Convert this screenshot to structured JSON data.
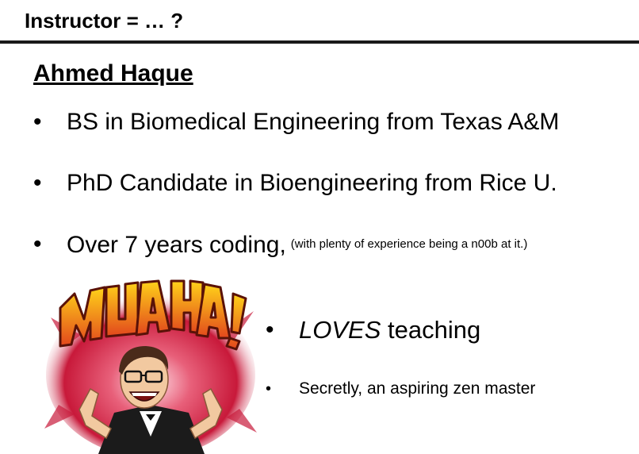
{
  "slide": {
    "title": "Instructor = … ?",
    "name": "Ahmed Haque",
    "bullets": [
      {
        "text": "BS in Biomedical Engineering from Texas A&M"
      },
      {
        "text": "PhD Candidate in Bioengineering from Rice U."
      },
      {
        "text": "Over 7 years coding,",
        "note": "(with plenty of experience being a n00b at it.)"
      }
    ],
    "side_bullets": [
      {
        "emphasis": "LOVES",
        "text": " teaching"
      },
      {
        "text": "Secretly, an aspiring zen master"
      }
    ],
    "bullet_glyph": "•",
    "illustration": {
      "caption_art": "MUAHAHA!",
      "icon": "cartoon-avatar-laughing",
      "colors": {
        "burst": "#c8193a",
        "letters_top": "#ffd21a",
        "letters_bottom": "#e2471c",
        "outline": "#5a1208"
      }
    }
  }
}
